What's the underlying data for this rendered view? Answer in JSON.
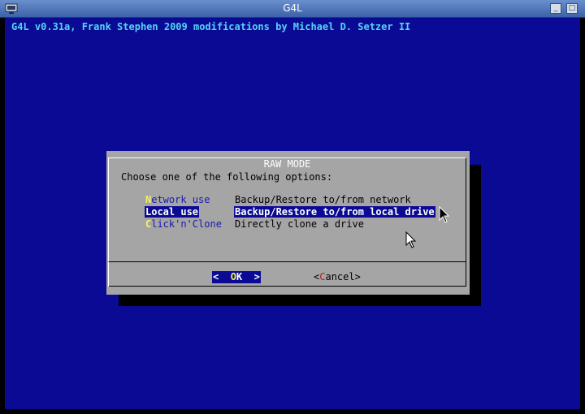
{
  "window": {
    "title": "G4L"
  },
  "backtitle": "G4L v0.31a, Frank Stephen 2009 modifications by Michael D. Setzer II",
  "dialog": {
    "title": "RAW MODE",
    "prompt": "Choose one of the following options:",
    "items": [
      {
        "hotkey": "N",
        "tag_rest": "etwork use",
        "description": "Backup/Restore to/from network",
        "selected": false
      },
      {
        "hotkey": "L",
        "tag_rest": "ocal use",
        "description": "Backup/Restore to/from local drive",
        "selected": true
      },
      {
        "hotkey": "C",
        "tag_rest": "lick'n'Clone",
        "description": "Directly clone a drive",
        "selected": false
      }
    ],
    "buttons": {
      "ok": {
        "left": "<  ",
        "hotkey": "O",
        "rest": "K  >"
      },
      "cancel": {
        "left": "<",
        "hotkey": "C",
        "rest": "ancel>"
      }
    }
  },
  "icons": {
    "window_icon": "monitor-icon",
    "minimize": "minimize-icon",
    "maximize": "maximize-icon",
    "cursor": "mouse-pointer-icon"
  },
  "colors": {
    "screen_bg": "#0b0a94",
    "dialog_bg": "#a5a5a5",
    "backtitle": "#52d6f6",
    "hotkey": "#f2f263",
    "cancel_hotkey": "#c01a1a"
  }
}
